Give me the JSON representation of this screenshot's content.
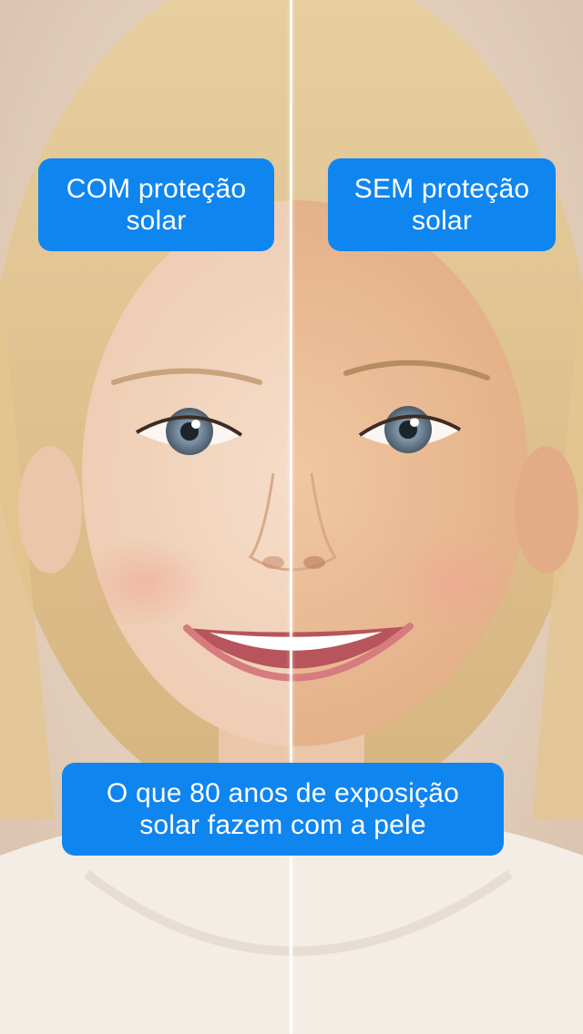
{
  "left_caption": {
    "line1": "COM proteção",
    "line2": "solar"
  },
  "right_caption": {
    "line1": "SEM proteção",
    "line2": "solar"
  },
  "bottom_caption": {
    "line1": "O que 80 anos de exposição",
    "line2": "solar fazem com a pele"
  },
  "colors": {
    "caption_background": "#0f85f0",
    "caption_text": "#ffffff",
    "divider": "#ffffff"
  }
}
